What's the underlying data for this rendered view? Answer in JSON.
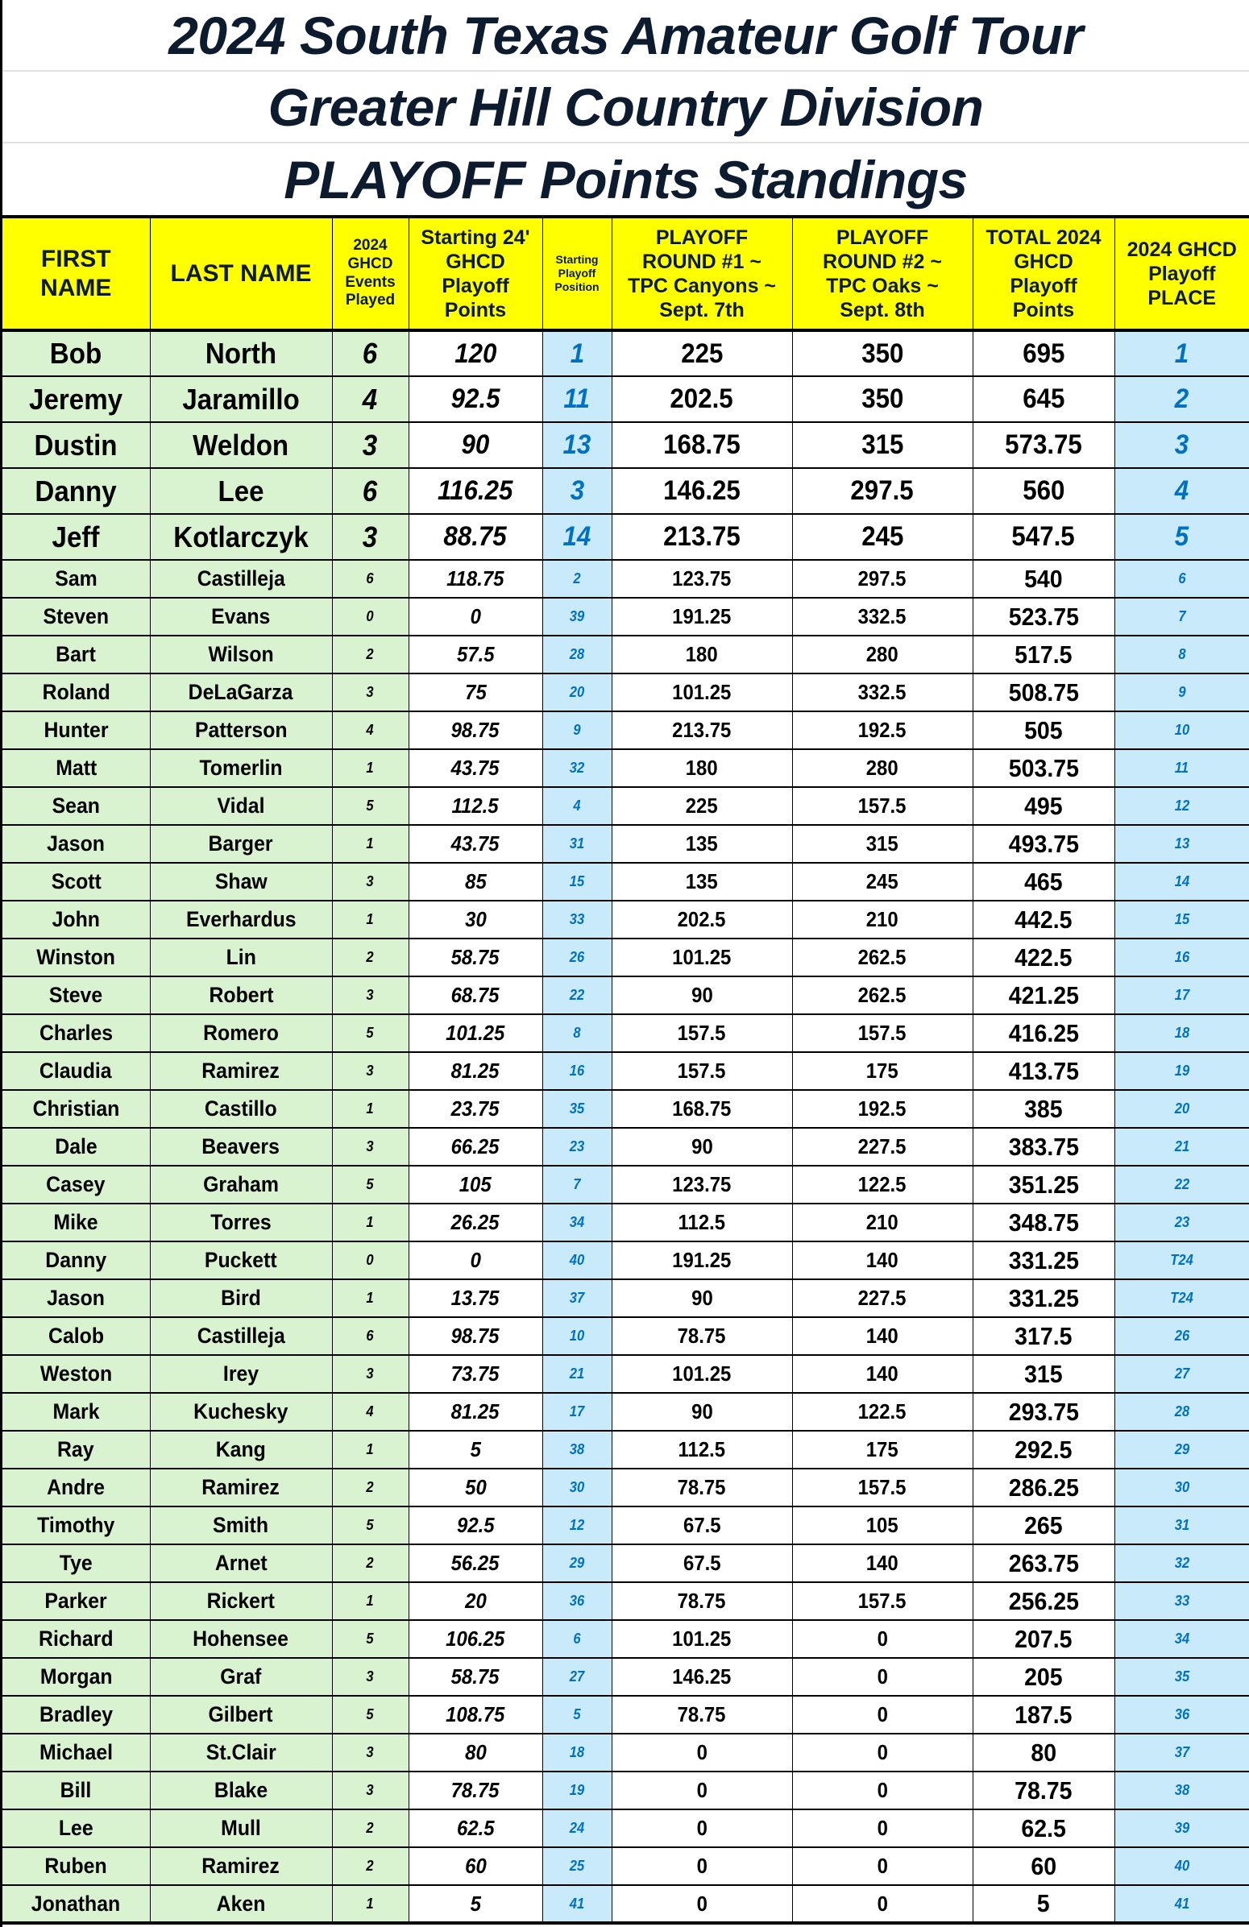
{
  "title": {
    "line1": "2024 South Texas Amateur Golf Tour",
    "line2": "Greater Hill Country Division",
    "line3": "PLAYOFF Points Standings"
  },
  "colors": {
    "header_bg": "#ffff00",
    "header_text": "#0d1b2e",
    "name_bg": "#d9f2d0",
    "position_bg": "#c9eafb",
    "position_text": "#0070c0"
  },
  "headers": {
    "first_name": [
      "FIRST",
      "NAME"
    ],
    "last_name": "LAST NAME",
    "events": [
      "2024",
      "GHCD",
      "Events",
      "Played"
    ],
    "starting_points": [
      "Starting 24'",
      "GHCD",
      "Playoff",
      "Points"
    ],
    "starting_position": [
      "Starting",
      "Playoff",
      "Position"
    ],
    "round1": [
      "PLAYOFF",
      "ROUND #1 ~",
      "TPC Canyons ~",
      "Sept. 7th"
    ],
    "round2": [
      "PLAYOFF",
      "ROUND #2 ~",
      "TPC Oaks ~",
      "Sept. 8th"
    ],
    "total": [
      "TOTAL 2024",
      "GHCD",
      "Playoff",
      "Points"
    ],
    "place": [
      "2024 GHCD",
      "Playoff",
      "PLACE"
    ]
  },
  "rows": [
    {
      "first": "Bob",
      "last": "North",
      "events": "6",
      "start": "120",
      "pos": "1",
      "r1": "225",
      "r2": "350",
      "total": "695",
      "place": "1"
    },
    {
      "first": "Jeremy",
      "last": "Jaramillo",
      "events": "4",
      "start": "92.5",
      "pos": "11",
      "r1": "202.5",
      "r2": "350",
      "total": "645",
      "place": "2"
    },
    {
      "first": "Dustin",
      "last": "Weldon",
      "events": "3",
      "start": "90",
      "pos": "13",
      "r1": "168.75",
      "r2": "315",
      "total": "573.75",
      "place": "3"
    },
    {
      "first": "Danny",
      "last": "Lee",
      "events": "6",
      "start": "116.25",
      "pos": "3",
      "r1": "146.25",
      "r2": "297.5",
      "total": "560",
      "place": "4"
    },
    {
      "first": "Jeff",
      "last": "Kotlarczyk",
      "events": "3",
      "start": "88.75",
      "pos": "14",
      "r1": "213.75",
      "r2": "245",
      "total": "547.5",
      "place": "5"
    },
    {
      "first": "Sam",
      "last": "Castilleja",
      "events": "6",
      "start": "118.75",
      "pos": "2",
      "r1": "123.75",
      "r2": "297.5",
      "total": "540",
      "place": "6"
    },
    {
      "first": "Steven",
      "last": "Evans",
      "events": "0",
      "start": "0",
      "pos": "39",
      "r1": "191.25",
      "r2": "332.5",
      "total": "523.75",
      "place": "7"
    },
    {
      "first": "Bart",
      "last": "Wilson",
      "events": "2",
      "start": "57.5",
      "pos": "28",
      "r1": "180",
      "r2": "280",
      "total": "517.5",
      "place": "8"
    },
    {
      "first": "Roland",
      "last": "DeLaGarza",
      "events": "3",
      "start": "75",
      "pos": "20",
      "r1": "101.25",
      "r2": "332.5",
      "total": "508.75",
      "place": "9"
    },
    {
      "first": "Hunter",
      "last": "Patterson",
      "events": "4",
      "start": "98.75",
      "pos": "9",
      "r1": "213.75",
      "r2": "192.5",
      "total": "505",
      "place": "10"
    },
    {
      "first": "Matt",
      "last": "Tomerlin",
      "events": "1",
      "start": "43.75",
      "pos": "32",
      "r1": "180",
      "r2": "280",
      "total": "503.75",
      "place": "11"
    },
    {
      "first": "Sean",
      "last": "Vidal",
      "events": "5",
      "start": "112.5",
      "pos": "4",
      "r1": "225",
      "r2": "157.5",
      "total": "495",
      "place": "12"
    },
    {
      "first": "Jason",
      "last": "Barger",
      "events": "1",
      "start": "43.75",
      "pos": "31",
      "r1": "135",
      "r2": "315",
      "total": "493.75",
      "place": "13"
    },
    {
      "first": "Scott",
      "last": "Shaw",
      "events": "3",
      "start": "85",
      "pos": "15",
      "r1": "135",
      "r2": "245",
      "total": "465",
      "place": "14"
    },
    {
      "first": "John",
      "last": "Everhardus",
      "events": "1",
      "start": "30",
      "pos": "33",
      "r1": "202.5",
      "r2": "210",
      "total": "442.5",
      "place": "15"
    },
    {
      "first": "Winston",
      "last": "Lin",
      "events": "2",
      "start": "58.75",
      "pos": "26",
      "r1": "101.25",
      "r2": "262.5",
      "total": "422.5",
      "place": "16"
    },
    {
      "first": "Steve",
      "last": "Robert",
      "events": "3",
      "start": "68.75",
      "pos": "22",
      "r1": "90",
      "r2": "262.5",
      "total": "421.25",
      "place": "17"
    },
    {
      "first": "Charles",
      "last": "Romero",
      "events": "5",
      "start": "101.25",
      "pos": "8",
      "r1": "157.5",
      "r2": "157.5",
      "total": "416.25",
      "place": "18"
    },
    {
      "first": "Claudia",
      "last": "Ramirez",
      "events": "3",
      "start": "81.25",
      "pos": "16",
      "r1": "157.5",
      "r2": "175",
      "total": "413.75",
      "place": "19"
    },
    {
      "first": "Christian",
      "last": "Castillo",
      "events": "1",
      "start": "23.75",
      "pos": "35",
      "r1": "168.75",
      "r2": "192.5",
      "total": "385",
      "place": "20"
    },
    {
      "first": "Dale",
      "last": "Beavers",
      "events": "3",
      "start": "66.25",
      "pos": "23",
      "r1": "90",
      "r2": "227.5",
      "total": "383.75",
      "place": "21"
    },
    {
      "first": "Casey",
      "last": "Graham",
      "events": "5",
      "start": "105",
      "pos": "7",
      "r1": "123.75",
      "r2": "122.5",
      "total": "351.25",
      "place": "22"
    },
    {
      "first": "Mike",
      "last": "Torres",
      "events": "1",
      "start": "26.25",
      "pos": "34",
      "r1": "112.5",
      "r2": "210",
      "total": "348.75",
      "place": "23"
    },
    {
      "first": "Danny",
      "last": "Puckett",
      "events": "0",
      "start": "0",
      "pos": "40",
      "r1": "191.25",
      "r2": "140",
      "total": "331.25",
      "place": "T24"
    },
    {
      "first": "Jason",
      "last": "Bird",
      "events": "1",
      "start": "13.75",
      "pos": "37",
      "r1": "90",
      "r2": "227.5",
      "total": "331.25",
      "place": "T24"
    },
    {
      "first": "Calob",
      "last": "Castilleja",
      "events": "6",
      "start": "98.75",
      "pos": "10",
      "r1": "78.75",
      "r2": "140",
      "total": "317.5",
      "place": "26"
    },
    {
      "first": "Weston",
      "last": "Irey",
      "events": "3",
      "start": "73.75",
      "pos": "21",
      "r1": "101.25",
      "r2": "140",
      "total": "315",
      "place": "27"
    },
    {
      "first": "Mark",
      "last": "Kuchesky",
      "events": "4",
      "start": "81.25",
      "pos": "17",
      "r1": "90",
      "r2": "122.5",
      "total": "293.75",
      "place": "28"
    },
    {
      "first": "Ray",
      "last": "Kang",
      "events": "1",
      "start": "5",
      "pos": "38",
      "r1": "112.5",
      "r2": "175",
      "total": "292.5",
      "place": "29"
    },
    {
      "first": "Andre",
      "last": "Ramirez",
      "events": "2",
      "start": "50",
      "pos": "30",
      "r1": "78.75",
      "r2": "157.5",
      "total": "286.25",
      "place": "30"
    },
    {
      "first": "Timothy",
      "last": "Smith",
      "events": "5",
      "start": "92.5",
      "pos": "12",
      "r1": "67.5",
      "r2": "105",
      "total": "265",
      "place": "31"
    },
    {
      "first": "Tye",
      "last": "Arnet",
      "events": "2",
      "start": "56.25",
      "pos": "29",
      "r1": "67.5",
      "r2": "140",
      "total": "263.75",
      "place": "32"
    },
    {
      "first": "Parker",
      "last": "Rickert",
      "events": "1",
      "start": "20",
      "pos": "36",
      "r1": "78.75",
      "r2": "157.5",
      "total": "256.25",
      "place": "33"
    },
    {
      "first": "Richard",
      "last": "Hohensee",
      "events": "5",
      "start": "106.25",
      "pos": "6",
      "r1": "101.25",
      "r2": "0",
      "total": "207.5",
      "place": "34"
    },
    {
      "first": "Morgan",
      "last": "Graf",
      "events": "3",
      "start": "58.75",
      "pos": "27",
      "r1": "146.25",
      "r2": "0",
      "total": "205",
      "place": "35"
    },
    {
      "first": "Bradley",
      "last": "Gilbert",
      "events": "5",
      "start": "108.75",
      "pos": "5",
      "r1": "78.75",
      "r2": "0",
      "total": "187.5",
      "place": "36"
    },
    {
      "first": "Michael",
      "last": "St.Clair",
      "events": "3",
      "start": "80",
      "pos": "18",
      "r1": "0",
      "r2": "0",
      "total": "80",
      "place": "37"
    },
    {
      "first": "Bill",
      "last": "Blake",
      "events": "3",
      "start": "78.75",
      "pos": "19",
      "r1": "0",
      "r2": "0",
      "total": "78.75",
      "place": "38"
    },
    {
      "first": "Lee",
      "last": "Mull",
      "events": "2",
      "start": "62.5",
      "pos": "24",
      "r1": "0",
      "r2": "0",
      "total": "62.5",
      "place": "39"
    },
    {
      "first": "Ruben",
      "last": "Ramirez",
      "events": "2",
      "start": "60",
      "pos": "25",
      "r1": "0",
      "r2": "0",
      "total": "60",
      "place": "40"
    },
    {
      "first": "Jonathan",
      "last": "Aken",
      "events": "1",
      "start": "5",
      "pos": "41",
      "r1": "0",
      "r2": "0",
      "total": "5",
      "place": "41"
    }
  ]
}
